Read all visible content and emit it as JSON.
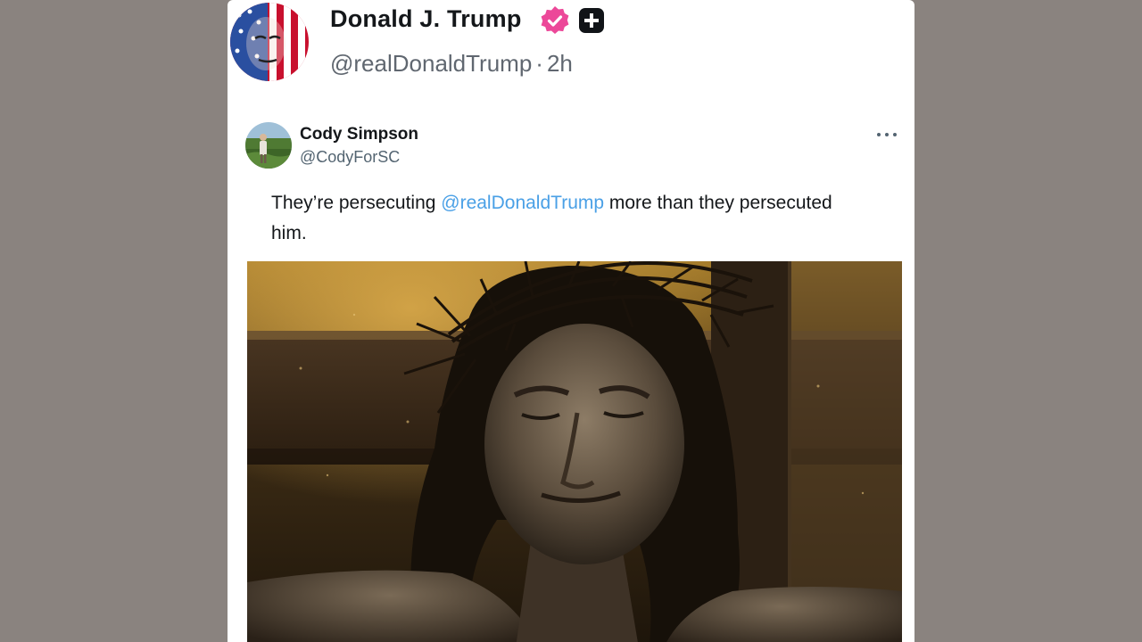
{
  "post": {
    "author_name": "Donald J. Trump",
    "author_handle": "@realDonaldTrump",
    "separator": "·",
    "time_ago": "2h",
    "verified_icon": "verified-badge-icon",
    "plus_icon": "plus-badge-icon"
  },
  "quoted": {
    "author_name": "Cody Simpson",
    "author_handle": "@CodyForSC",
    "more_icon": "more-options-icon",
    "text_before": "They’re persecuting ",
    "mention": "@realDonaldTrump",
    "text_after": " more than they persecuted him."
  },
  "colors": {
    "page_background": "#8a837f",
    "verified_badge": "#ec4899",
    "mention_link": "#4aa0e6"
  }
}
